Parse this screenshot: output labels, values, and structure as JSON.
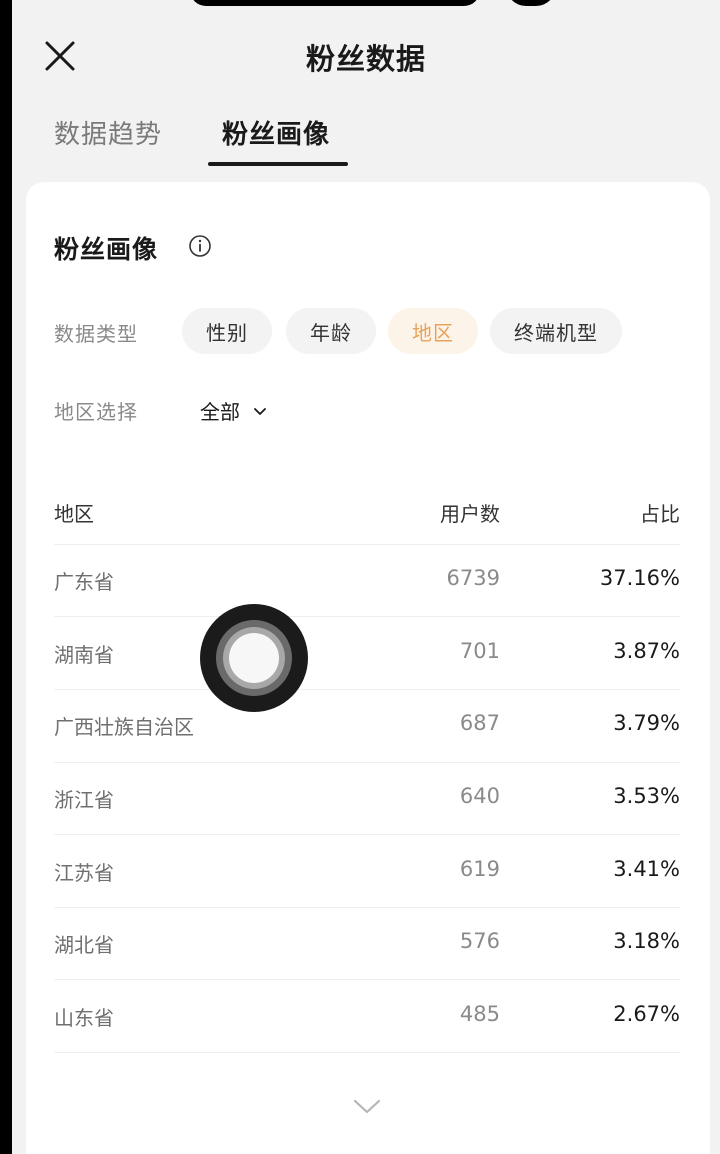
{
  "header": {
    "title": "粉丝数据",
    "close_icon": "close-icon"
  },
  "tabs": [
    {
      "label": "数据趋势",
      "active": false
    },
    {
      "label": "粉丝画像",
      "active": true
    }
  ],
  "card": {
    "title": "粉丝画像",
    "info_icon": "info-icon",
    "data_type_label": "数据类型",
    "chips": [
      {
        "label": "性别",
        "selected": false
      },
      {
        "label": "年龄",
        "selected": false
      },
      {
        "label": "地区",
        "selected": true
      },
      {
        "label": "终端机型",
        "selected": false
      }
    ],
    "region_select_label": "地区选择",
    "region_select_value": "全部",
    "table": {
      "headers": {
        "region": "地区",
        "users": "用户数",
        "pct": "占比"
      },
      "rows": [
        {
          "region": "广东省",
          "users": "6739",
          "pct": "37.16%"
        },
        {
          "region": "湖南省",
          "users": "701",
          "pct": "3.87%"
        },
        {
          "region": "广西壮族自治区",
          "users": "687",
          "pct": "3.79%"
        },
        {
          "region": "浙江省",
          "users": "640",
          "pct": "3.53%"
        },
        {
          "region": "江苏省",
          "users": "619",
          "pct": "3.41%"
        },
        {
          "region": "湖北省",
          "users": "576",
          "pct": "3.18%"
        },
        {
          "region": "山东省",
          "users": "485",
          "pct": "2.67%"
        }
      ]
    },
    "more_icon": "chevron-down-icon"
  },
  "colors": {
    "accent": "#e8a35a",
    "accent_bg": "#fdf4e9",
    "background": "#f2f2f2",
    "card": "#ffffff"
  }
}
